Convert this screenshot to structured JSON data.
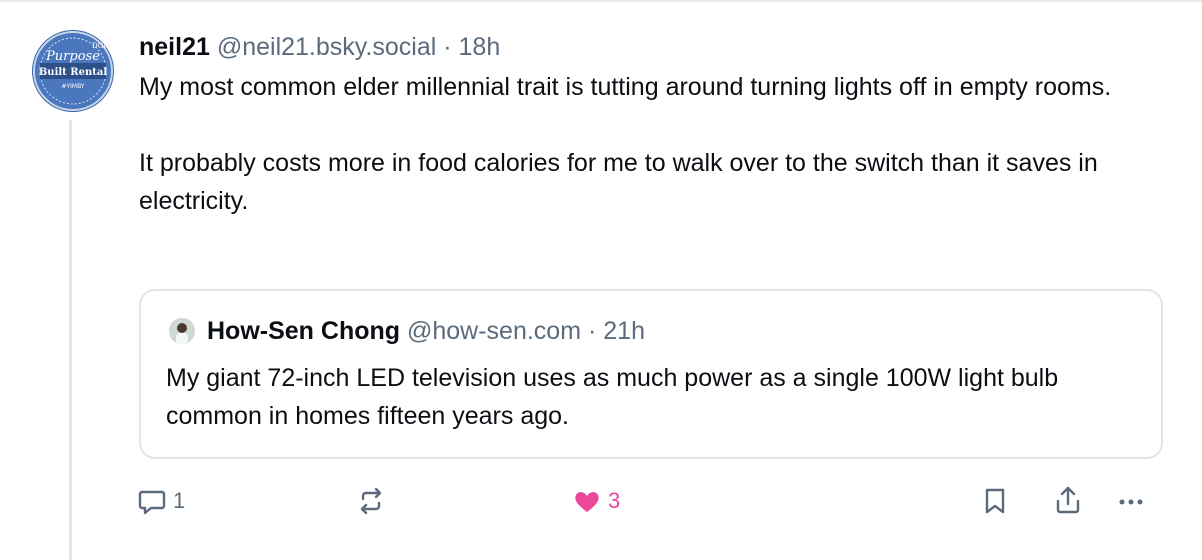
{
  "post": {
    "display_name": "neil21",
    "handle": "@neil21.bsky.social",
    "separator": "·",
    "time": "18h",
    "text_p1": "My most common elder millennial trait is tutting around turning lights off in empty rooms.",
    "text_p2": "It probably costs more in food calories for me to walk over to the switch than it saves in electricity.",
    "avatar_text": {
      "top": "DGL",
      "line1": "Purpose",
      "line2": "Built Rental",
      "line3": "#YIMBY"
    }
  },
  "quote": {
    "display_name": "How-Sen Chong",
    "handle": "@how-sen.com",
    "separator": "·",
    "time": "21h",
    "text": "My giant 72-inch LED television uses as much power as a single 100W light bulb common in homes fifteen years ago."
  },
  "actions": {
    "reply_count": "1",
    "like_count": "3",
    "icons": [
      "reply-icon",
      "repost-icon",
      "like-icon",
      "bookmark-icon",
      "share-icon",
      "more-icon"
    ],
    "like_color": "#ec4899"
  }
}
